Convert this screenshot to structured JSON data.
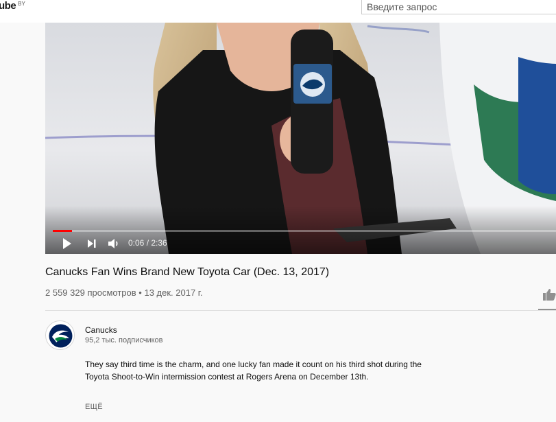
{
  "masthead": {
    "logo_text": "ube",
    "country_code": "BY",
    "search_placeholder": "Введите запрос"
  },
  "player": {
    "time_current": "0:06",
    "time_separator": " / ",
    "time_total": "2:36",
    "progress_fraction": 0.038,
    "accent_color": "#ff0000",
    "icons": [
      "play-icon",
      "next-icon",
      "volume-icon"
    ]
  },
  "video": {
    "title": "Canucks Fan Wins Brand New Toyota Car (Dec. 13, 2017)",
    "views": "2 559 329 просмотров",
    "separator": "•",
    "date": "13 дек. 2017 г."
  },
  "channel": {
    "name": "Canucks",
    "subscribers": "95,2 тыс. подписчиков",
    "description_line1": "They say third time is the charm, and one lucky fan made it count on his third shot during the",
    "description_line2": "Toyota Shoot-to-Win intermission contest at Rogers Arena on December 13th.",
    "more_label": "ЕЩЁ"
  }
}
